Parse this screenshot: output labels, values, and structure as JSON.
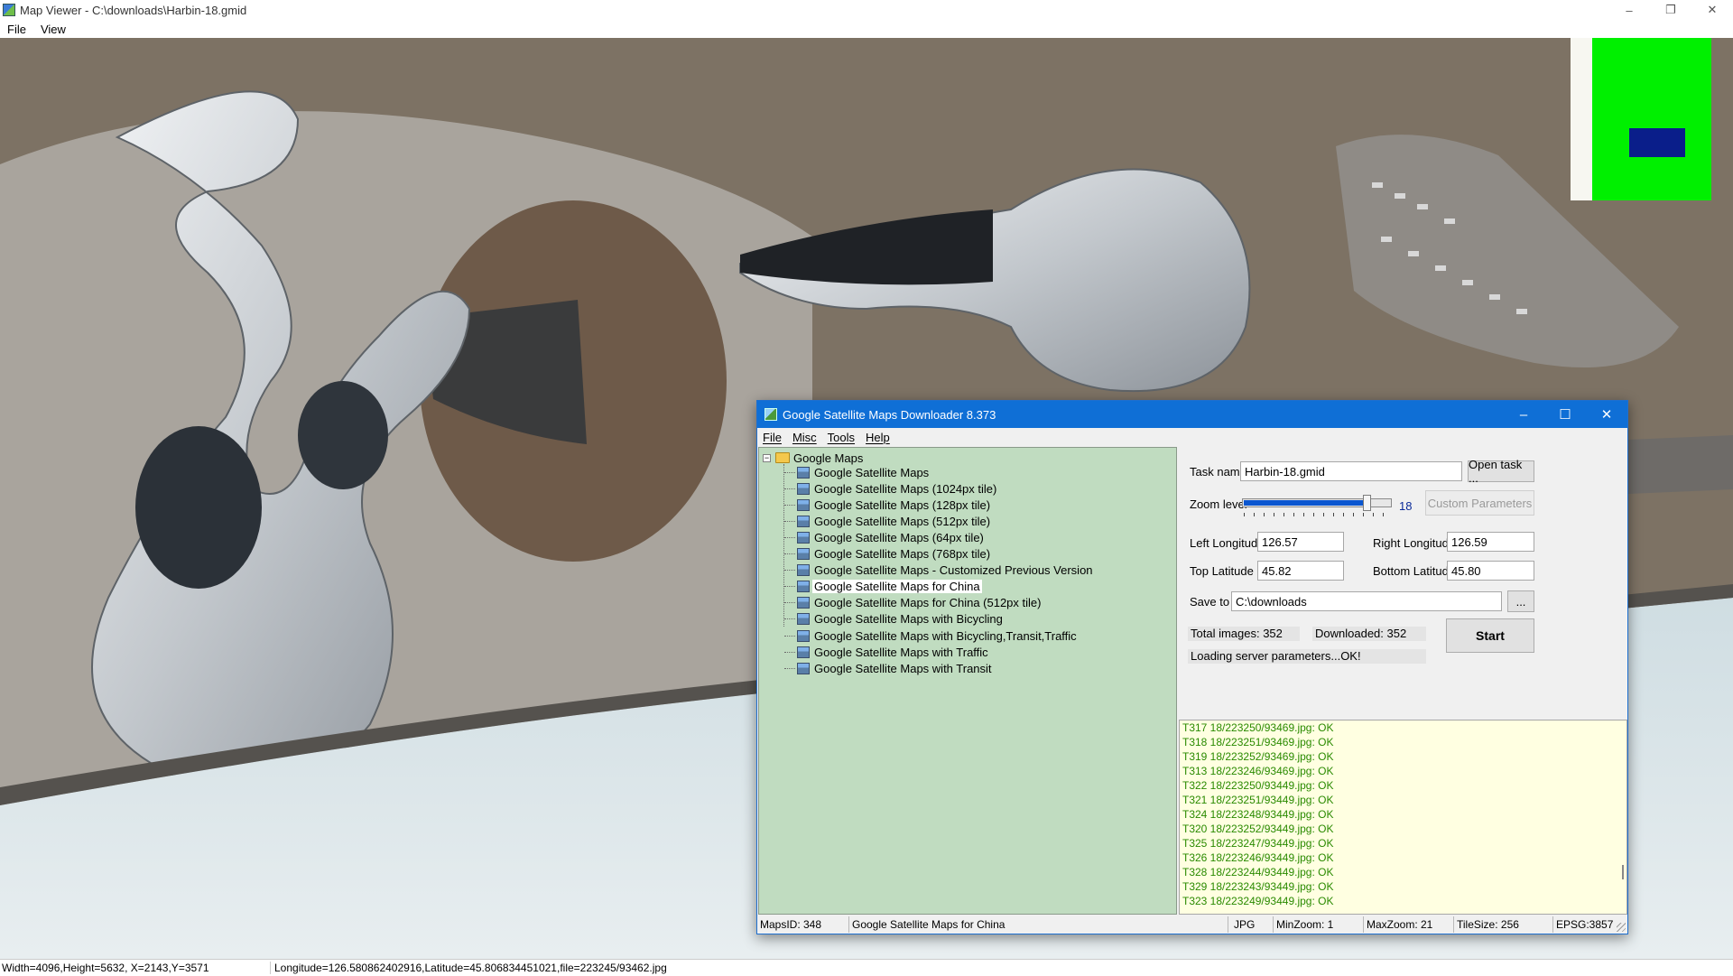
{
  "viewer": {
    "title": "Map Viewer - C:\\downloads\\Harbin-18.gmid",
    "menu": [
      "File",
      "View"
    ],
    "status_left": "Width=4096,Height=5632, X=2143,Y=3571",
    "status_right": "Longitude=126.580862402916,Latitude=45.806834451021,file=223245/93462.jpg"
  },
  "dialog": {
    "title": "Google Satellite Maps Downloader 8.373",
    "menu": [
      "File",
      "Misc",
      "Tools",
      "Help"
    ],
    "tree": {
      "root": "Google Maps",
      "items": [
        "Google Satellite Maps",
        "Google Satellite Maps (1024px tile)",
        "Google Satellite Maps (128px tile)",
        "Google Satellite Maps (512px tile)",
        "Google Satellite Maps (64px tile)",
        "Google Satellite Maps (768px tile)",
        "Google Satellite Maps - Customized Previous Version",
        "Google Satellite Maps for China",
        "Google Satellite Maps for China (512px tile)",
        "Google Satellite Maps with Bicycling",
        "Google Satellite Maps with Bicycling,Transit,Traffic",
        "Google Satellite Maps with Traffic",
        "Google Satellite Maps with Transit"
      ],
      "selected": "Google Satellite Maps for China"
    },
    "form": {
      "task_name_label": "Task name",
      "task_name": "Harbin-18.gmid",
      "open_task": "Open task ...",
      "zoom_label": "Zoom level",
      "zoom_value": "18",
      "zoom_fraction": 0.857,
      "custom_params": "Custom Parameters",
      "left_lon_label": "Left Longitude",
      "left_lon": "126.57",
      "right_lon_label": "Right Longitude",
      "right_lon": "126.59",
      "top_lat_label": "Top Latitude",
      "top_lat": "45.82",
      "bottom_lat_label": "Bottom Latitude",
      "bottom_lat": "45.80",
      "save_to_label": "Save to",
      "save_to": "C:\\downloads",
      "browse": "...",
      "total_images": "Total images: 352",
      "downloaded": "Downloaded: 352",
      "status": "Loading server parameters...OK!",
      "start": "Start"
    },
    "log": [
      "T317 18/223250/93469.jpg: OK",
      "T318 18/223251/93469.jpg: OK",
      "T319 18/223252/93469.jpg: OK",
      "T313 18/223246/93469.jpg: OK",
      "T322 18/223250/93449.jpg: OK",
      "T321 18/223251/93449.jpg: OK",
      "T324 18/223248/93449.jpg: OK",
      "T320 18/223252/93449.jpg: OK",
      "T325 18/223247/93449.jpg: OK",
      "T326 18/223246/93449.jpg: OK",
      "T328 18/223244/93449.jpg: OK",
      "T329 18/223243/93449.jpg: OK",
      "T323 18/223249/93449.jpg: OK"
    ],
    "statusbar": {
      "maps_id": "MapsID: 348",
      "map_name": "Google Satellite Maps for China",
      "format": "JPG",
      "min_zoom": "MinZoom: 1",
      "max_zoom": "MaxZoom: 21",
      "tile_size": "TileSize: 256",
      "epsg": "EPSG:3857"
    }
  },
  "colors": {
    "titlebar": "#0f6fd6",
    "tree_bg": "#c0dcc0",
    "log_bg": "#ffffe1",
    "log_text": "#2a8a00",
    "overview_green": "#00f000",
    "overview_view": "#0a1e8a"
  }
}
